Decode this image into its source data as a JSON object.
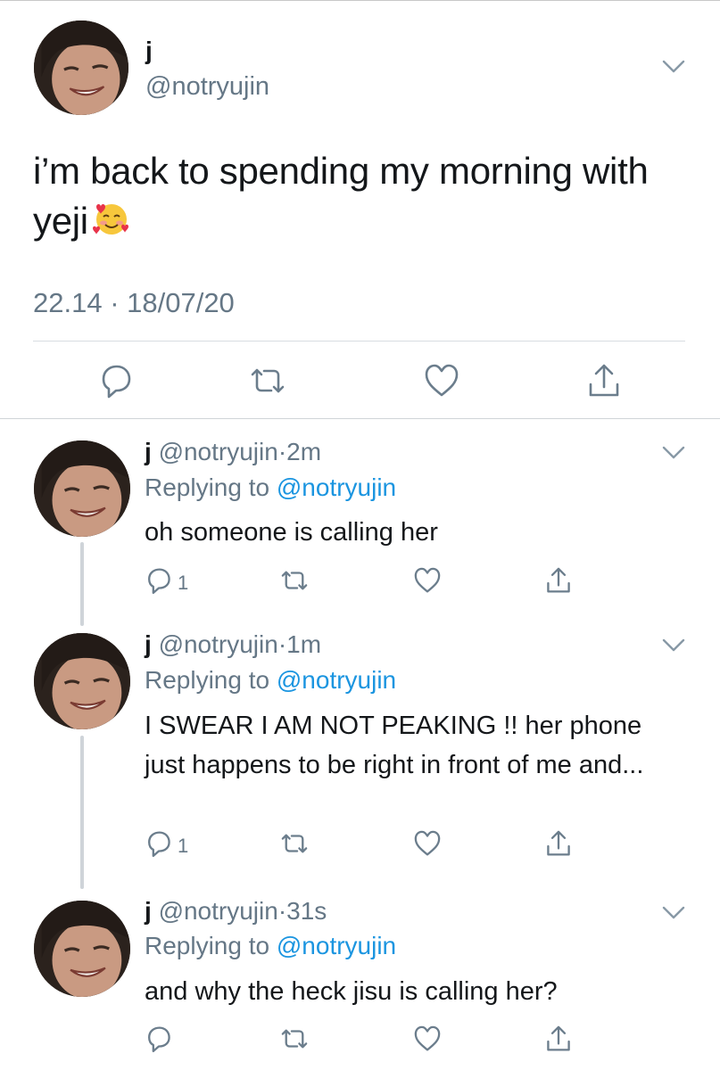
{
  "main_tweet": {
    "name": "j",
    "handle": "@notryujin",
    "text": "i’m back to spending my morning with yeji",
    "emoji": "smiling-face-with-hearts",
    "timestamp": "22.14 · 18/07/20"
  },
  "replies": [
    {
      "name": "j",
      "handle": "@notryujin",
      "separator": "·",
      "time_ago": "2m",
      "replying_prefix": "Replying to",
      "replying_to": "@notryujin",
      "text": "oh someone is calling her",
      "reply_count": "1"
    },
    {
      "name": "j",
      "handle": "@notryujin",
      "separator": "·",
      "time_ago": "1m",
      "replying_prefix": "Replying to",
      "replying_to": "@notryujin",
      "text": "I SWEAR I AM NOT PEAKING !! her phone just happens to be right in front of me and...",
      "reply_count": "1"
    },
    {
      "name": "j",
      "handle": "@notryujin",
      "separator": "·",
      "time_ago": "31s",
      "replying_prefix": "Replying to",
      "replying_to": "@notryujin",
      "text": "and why the heck jisu is calling her?",
      "reply_count": ""
    }
  ],
  "colors": {
    "text": "#14171a",
    "secondary": "#657786",
    "link": "#1b95e0",
    "divider": "#d8dde2",
    "thread_line": "#cfd4d9"
  },
  "icons": [
    "chevron-down-icon",
    "reply-icon",
    "retweet-icon",
    "like-icon",
    "share-icon"
  ]
}
